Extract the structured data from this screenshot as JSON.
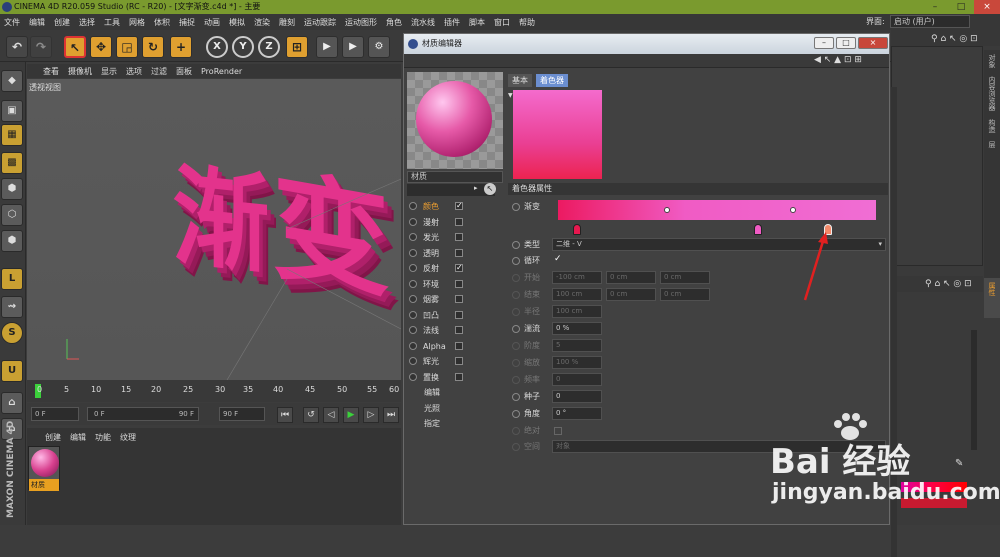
{
  "window": {
    "title": "CINEMA 4D R20.059 Studio (RC - R20) - [文字渐变.c4d *] - 主要"
  },
  "menubar": {
    "items": [
      "文件",
      "编辑",
      "创建",
      "选择",
      "工具",
      "网格",
      "体积",
      "捕捉",
      "动画",
      "模拟",
      "渲染",
      "雕刻",
      "运动跟踪",
      "运动图形",
      "角色",
      "流水线",
      "插件",
      "脚本",
      "窗口",
      "帮助"
    ],
    "interface_label": "界面:",
    "interface_value": "启动 (用户)"
  },
  "toolbar": {
    "icons": [
      "undo-icon",
      "redo-icon",
      "select-icon",
      "move-icon",
      "scale-icon",
      "rotate-icon",
      "add-icon",
      "x-axis-icon",
      "y-axis-icon",
      "z-axis-icon",
      "coordinate-icon",
      "render-view-icon",
      "render-icon",
      "render-settings-icon"
    ],
    "x": "X",
    "y": "Y",
    "z": "Z"
  },
  "viewport": {
    "menu": [
      "查看",
      "摄像机",
      "显示",
      "选项",
      "过滤",
      "面板",
      "ProRender"
    ],
    "label": "透视视图",
    "text3d": [
      "渐",
      "变"
    ]
  },
  "timeline": {
    "ticks": [
      "0",
      "5",
      "10",
      "15",
      "20",
      "25",
      "30",
      "35",
      "40",
      "45",
      "50",
      "55",
      "60"
    ]
  },
  "playback": {
    "start": "0 F",
    "current": "0 F",
    "end_small": "90 F",
    "end": "90 F"
  },
  "material_manager": {
    "menu": [
      "创建",
      "编辑",
      "功能",
      "纹理"
    ],
    "material_name": "材质"
  },
  "maxon": {
    "text": "MAXON CINEMA 4D"
  },
  "editor": {
    "title": "材质编辑器",
    "preview_name": "材质",
    "tabs": [
      "基本",
      "着色器"
    ],
    "channels": [
      {
        "name": "颜色",
        "checked": true,
        "selected": true
      },
      {
        "name": "漫射",
        "checked": false
      },
      {
        "name": "发光",
        "checked": false
      },
      {
        "name": "透明",
        "checked": false
      },
      {
        "name": "反射",
        "checked": true
      },
      {
        "name": "环境",
        "checked": false
      },
      {
        "name": "烟雾",
        "checked": false
      },
      {
        "name": "凹凸",
        "checked": false
      },
      {
        "name": "法线",
        "checked": false
      },
      {
        "name": "Alpha",
        "checked": false
      },
      {
        "name": "辉光",
        "checked": false
      },
      {
        "name": "置换",
        "checked": false
      },
      {
        "name": "编辑"
      },
      {
        "name": "光照"
      },
      {
        "name": "指定"
      }
    ],
    "section": "着色器属性",
    "gradient_label": "渐变",
    "type_label": "类型",
    "type_value": "二维 - V",
    "cycle_label": "循环",
    "start_label": "开始",
    "start_values": [
      "-100 cm",
      "0 cm",
      "0 cm"
    ],
    "end_label": "结束",
    "end_values": [
      "100 cm",
      "0 cm",
      "0 cm"
    ],
    "radius_label": "半径",
    "radius_value": "100 cm",
    "turbulence_label": "湍流",
    "turbulence_value": "0 %",
    "octaves_label": "阶度",
    "octaves_value": "5",
    "scale_label": "缩放",
    "scale_value": "100 %",
    "frequency_label": "频率",
    "frequency_value": "0",
    "seed_label": "种子",
    "seed_value": "0",
    "angle_label": "角度",
    "angle_value": "0 °",
    "absolute_label": "绝对",
    "space_label": "空间",
    "space_value": "对象",
    "colors": {
      "gradient_start": "#ec1a61",
      "gradient_end": "#f06ed4"
    }
  },
  "rightpanel": {
    "vtabs": [
      "对象",
      "内容浏览器",
      "构造",
      "层"
    ],
    "attr_tab": "属性"
  },
  "watermark": {
    "line1": "Bai 经验",
    "line2": "jingyan.baidu.com"
  }
}
